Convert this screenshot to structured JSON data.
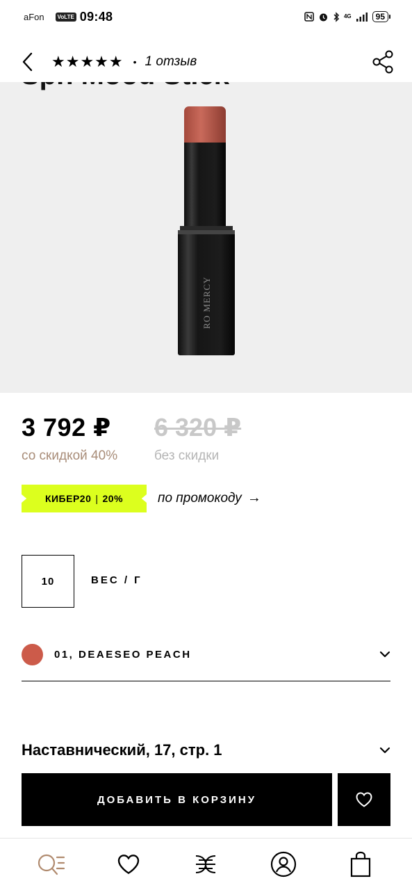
{
  "status_bar": {
    "carrier": "aFon",
    "volte": "VoLTE",
    "time": "09:48",
    "network": "4G",
    "battery": "95"
  },
  "header": {
    "stars": "★★★★★",
    "rating": 5,
    "separator": "•",
    "reviews": "1 отзыв",
    "icons": [
      "back-arrow-icon",
      "share-icon"
    ]
  },
  "product": {
    "title_peek": "Sph Mood Stick",
    "brand_on_tube": "RO MERCY"
  },
  "price": {
    "current": "3 792 ₽",
    "old": "6 320 ₽",
    "discount_label": "со скидкой 40%",
    "no_discount_label": "без скидки"
  },
  "promo": {
    "code": "КИБЕР20",
    "separator": "|",
    "percent": "20%",
    "link": "по промокоду",
    "link_arrow": "→"
  },
  "weight": {
    "value": "10",
    "label": "ВЕС / Г"
  },
  "shade": {
    "name": "01, DEAESEO PEACH",
    "swatch_color": "#cc5b4a"
  },
  "store": {
    "address": "Наставнический, 17, стр. 1"
  },
  "actions": {
    "add_to_cart": "ДОБАВИТЬ В КОРЗИНУ"
  },
  "nav": {
    "items": [
      "search-catalog-icon",
      "favorites-icon",
      "home-logo-icon",
      "profile-icon",
      "cart-icon"
    ]
  },
  "colors": {
    "promo_bg": "#dcff1e",
    "discount_text": "#a88c78",
    "old_price": "#c8c8c8",
    "image_bg": "#efefef",
    "nav_accent": "#b08a6e"
  }
}
